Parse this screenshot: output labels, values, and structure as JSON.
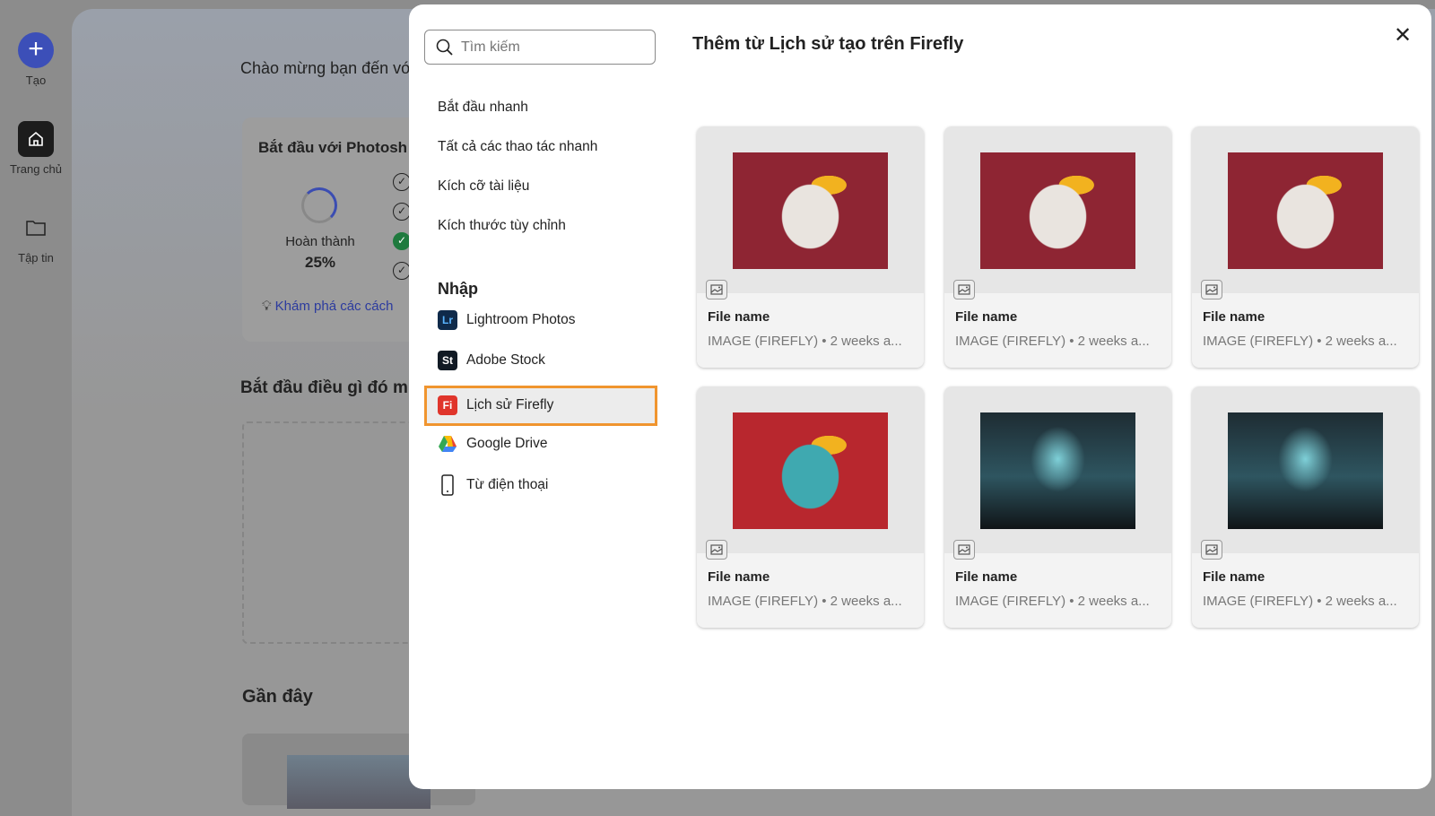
{
  "rail": {
    "create": "Tạo",
    "home": "Trang chủ",
    "files": "Tập tin"
  },
  "background": {
    "welcome": "Chào mừng bạn đến với",
    "card_title": "Bắt đầu với Photosh",
    "progress_label": "Hoàn thành",
    "progress_value": "25%",
    "progress_fraction": 0.25,
    "tip": "Khám phá các cách",
    "section_start": "Bắt đầu điều gì đó m",
    "recent": "Gần đây"
  },
  "modal": {
    "search_placeholder": "Tìm kiếm",
    "title": "Thêm từ Lịch sử tạo trên Firefly",
    "close": "✕",
    "nav": [
      "Bắt đầu nhanh",
      "Tất cả các thao tác nhanh",
      "Kích cỡ tài liệu",
      "Kích thước tùy chỉnh"
    ],
    "import_heading": "Nhập",
    "sources": [
      {
        "label": "Lightroom Photos",
        "badge": "Lr",
        "color": "#0f2a4a"
      },
      {
        "label": "Adobe Stock",
        "badge": "St",
        "color": "#111a24"
      },
      {
        "label": "Lịch sử Firefly",
        "badge": "Fi",
        "color": "#e0352b",
        "selected": true
      },
      {
        "label": "Google Drive",
        "icon": "google-drive-icon"
      },
      {
        "label": "Từ điện thoại",
        "icon": "phone-icon"
      }
    ],
    "files": [
      {
        "name": "File name",
        "meta": "IMAGE (FIREFLY) • 2 weeks a..."
      },
      {
        "name": "File name",
        "meta": "IMAGE (FIREFLY) • 2 weeks a..."
      },
      {
        "name": "File name",
        "meta": "IMAGE (FIREFLY) • 2 weeks a..."
      },
      {
        "name": "File name",
        "meta": "IMAGE (FIREFLY) • 2 weeks a..."
      },
      {
        "name": "File name",
        "meta": "IMAGE (FIREFLY) • 2 weeks a..."
      },
      {
        "name": "File name",
        "meta": "IMAGE (FIREFLY) • 2 weeks a..."
      }
    ],
    "accent": "#f0952f"
  }
}
